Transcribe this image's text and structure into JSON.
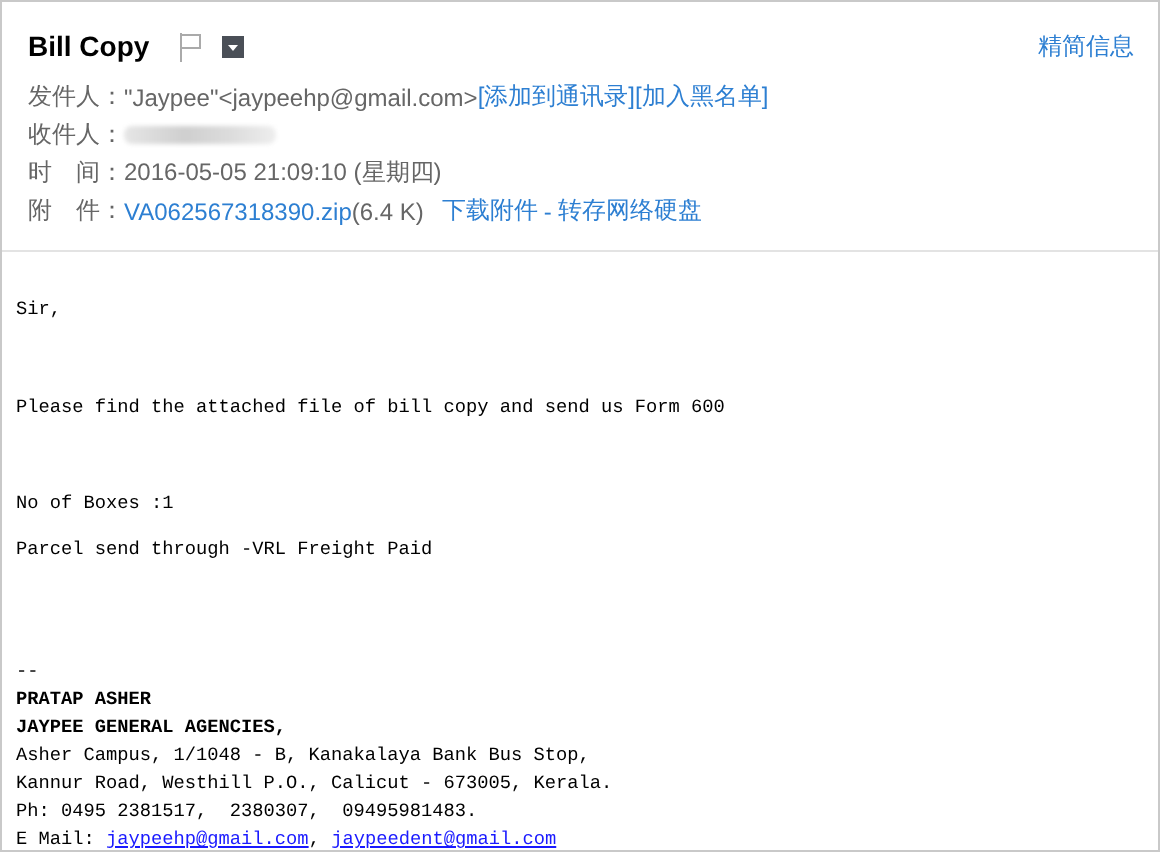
{
  "subject": "Bill Copy",
  "summary_link": "精简信息",
  "sender": {
    "label": "发件人：",
    "value": "\"Jaypee\"<jaypeehp@gmail.com>",
    "actions": [
      "[添加到通讯录]",
      "[加入黑名单]"
    ]
  },
  "recipient": {
    "label": "收件人："
  },
  "time": {
    "label": "时　间：",
    "value": "2016-05-05 21:09:10 (星期四)"
  },
  "attachment": {
    "label": "附　件：",
    "file": "VA062567318390.zip",
    "size": "(6.4 K)",
    "actions": [
      "下载附件",
      "转存网络硬盘"
    ],
    "separator": "-"
  },
  "paragraphs": [
    {
      "text": "Sir,"
    },
    {
      "text": "Please find the attached file of bill copy and send us Form 600"
    },
    {
      "text": "No of Boxes :1"
    },
    {
      "text": "Parcel send through -VRL Freight Paid"
    }
  ],
  "signature": {
    "dash": "--",
    "name": "PRATAP ASHER",
    "company": "JAYPEE GENERAL AGENCIES,",
    "address": [
      "Asher Campus, 1/1048 - B, Kanakalaya Bank Bus Stop,",
      "Kannur Road, Westhill P.O., Calicut - 673005, Kerala."
    ],
    "phone": "Ph: 0495 2381517,  2380307,  09495981483.",
    "email_label": "E Mail:",
    "emails": [
      "jaypeehp@gmail.com",
      "jaypeedent@gmail.com"
    ],
    "email_separator": ","
  }
}
